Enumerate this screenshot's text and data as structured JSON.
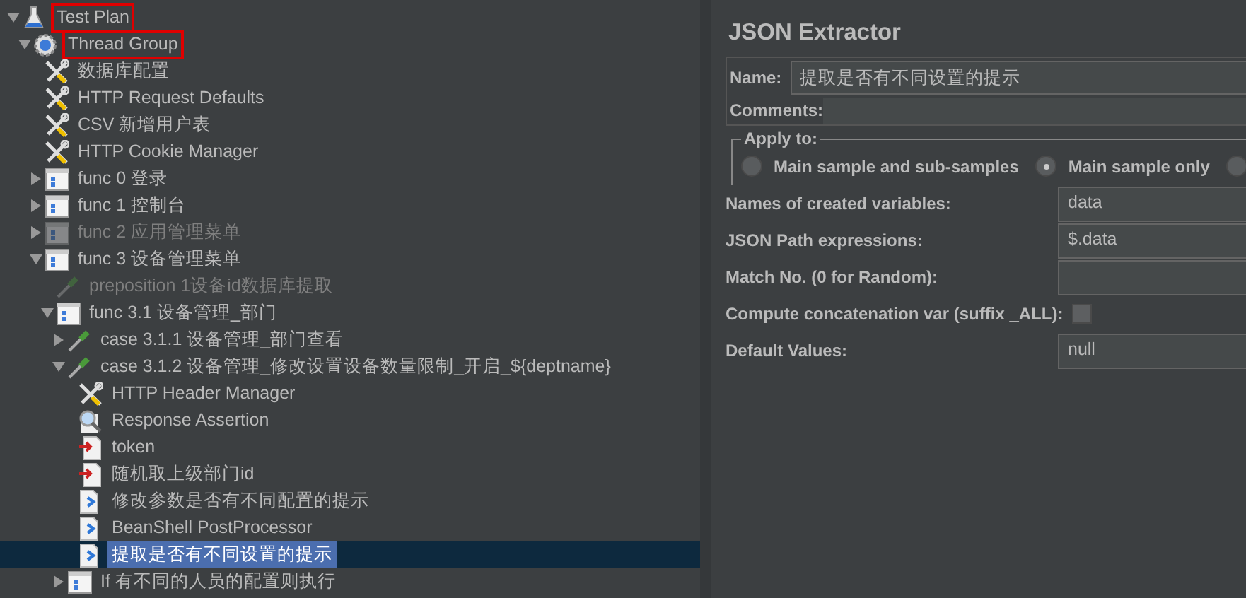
{
  "tree": [
    {
      "label": "Test Plan",
      "kind": "testplan",
      "expanded": true,
      "disabled": false,
      "selected": false,
      "outlined": true,
      "children": [
        {
          "label": "Thread Group",
          "kind": "thread",
          "expanded": true,
          "disabled": false,
          "selected": false,
          "outlined": true,
          "children": [
            {
              "label": "数据库配置",
              "kind": "config",
              "disabled": false,
              "selected": false,
              "outlined": false
            },
            {
              "label": "HTTP Request Defaults",
              "kind": "config",
              "disabled": false,
              "selected": false,
              "outlined": false
            },
            {
              "label": "CSV 新增用户表",
              "kind": "config",
              "disabled": false,
              "selected": false,
              "outlined": false
            },
            {
              "label": "HTTP Cookie Manager",
              "kind": "config",
              "disabled": false,
              "selected": false,
              "outlined": false
            },
            {
              "label": "func 0 登录",
              "kind": "controller",
              "expanded": false,
              "disabled": false,
              "selected": false,
              "outlined": false
            },
            {
              "label": "func 1  控制台",
              "kind": "controller",
              "expanded": false,
              "disabled": false,
              "selected": false,
              "outlined": false
            },
            {
              "label": "func 2  应用管理菜单",
              "kind": "controller",
              "expanded": false,
              "disabled": true,
              "selected": false,
              "outlined": false
            },
            {
              "label": "func 3  设备管理菜单",
              "kind": "controller",
              "expanded": true,
              "disabled": false,
              "selected": false,
              "outlined": false,
              "children": [
                {
                  "label": "preposition 1设备id数据库提取",
                  "kind": "sampler",
                  "disabled": true,
                  "selected": false,
                  "outlined": false
                },
                {
                  "label": "func 3.1  设备管理_部门",
                  "kind": "controller",
                  "expanded": true,
                  "disabled": false,
                  "selected": false,
                  "outlined": false,
                  "children": [
                    {
                      "label": "case 3.1.1  设备管理_部门查看",
                      "kind": "sampler",
                      "expanded": false,
                      "disabled": false,
                      "selected": false,
                      "outlined": false
                    },
                    {
                      "label": "case 3.1.2  设备管理_修改设置设备数量限制_开启_${deptname}",
                      "kind": "sampler",
                      "expanded": true,
                      "disabled": false,
                      "selected": false,
                      "outlined": false,
                      "children": [
                        {
                          "label": "HTTP Header Manager",
                          "kind": "config",
                          "disabled": false,
                          "selected": false,
                          "outlined": false
                        },
                        {
                          "label": "Response Assertion",
                          "kind": "assertion",
                          "disabled": false,
                          "selected": false,
                          "outlined": false
                        },
                        {
                          "label": "token",
                          "kind": "preprocessor",
                          "disabled": false,
                          "selected": false,
                          "outlined": false
                        },
                        {
                          "label": "随机取上级部门id",
                          "kind": "preprocessor",
                          "disabled": false,
                          "selected": false,
                          "outlined": false
                        },
                        {
                          "label": "修改参数是否有不同配置的提示",
                          "kind": "postprocessor",
                          "disabled": false,
                          "selected": false,
                          "outlined": false
                        },
                        {
                          "label": "BeanShell PostProcessor",
                          "kind": "postprocessor",
                          "disabled": false,
                          "selected": false,
                          "outlined": false
                        },
                        {
                          "label": "提取是否有不同设置的提示",
                          "kind": "postprocessor",
                          "disabled": false,
                          "selected": true,
                          "outlined": false
                        }
                      ]
                    },
                    {
                      "label": "If 有不同的人员的配置则执行",
                      "kind": "controller",
                      "expanded": false,
                      "disabled": false,
                      "selected": false,
                      "outlined": false
                    }
                  ]
                }
              ]
            }
          ]
        }
      ]
    }
  ],
  "panel": {
    "title": "JSON Extractor",
    "name": {
      "label": "Name:",
      "value": "提取是否有不同设置的提示"
    },
    "comments": {
      "label": "Comments:"
    },
    "apply_to": {
      "legend": "Apply to:",
      "options": [
        {
          "label": "Main sample and sub-samples",
          "selected": false
        },
        {
          "label": "Main sample only",
          "selected": true
        },
        {
          "selected": false
        }
      ]
    },
    "fields": [
      {
        "kind": "text",
        "label": "Names of created variables:",
        "value": "data"
      },
      {
        "kind": "text",
        "label": "JSON Path expressions:",
        "value": "$.data"
      },
      {
        "kind": "text",
        "label": "Match No. (0 for Random):"
      },
      {
        "kind": "checkbox",
        "label": "Compute concatenation var (suffix _ALL):",
        "checked": false
      },
      {
        "kind": "text",
        "label": "Default Values:",
        "value": "null"
      }
    ]
  }
}
